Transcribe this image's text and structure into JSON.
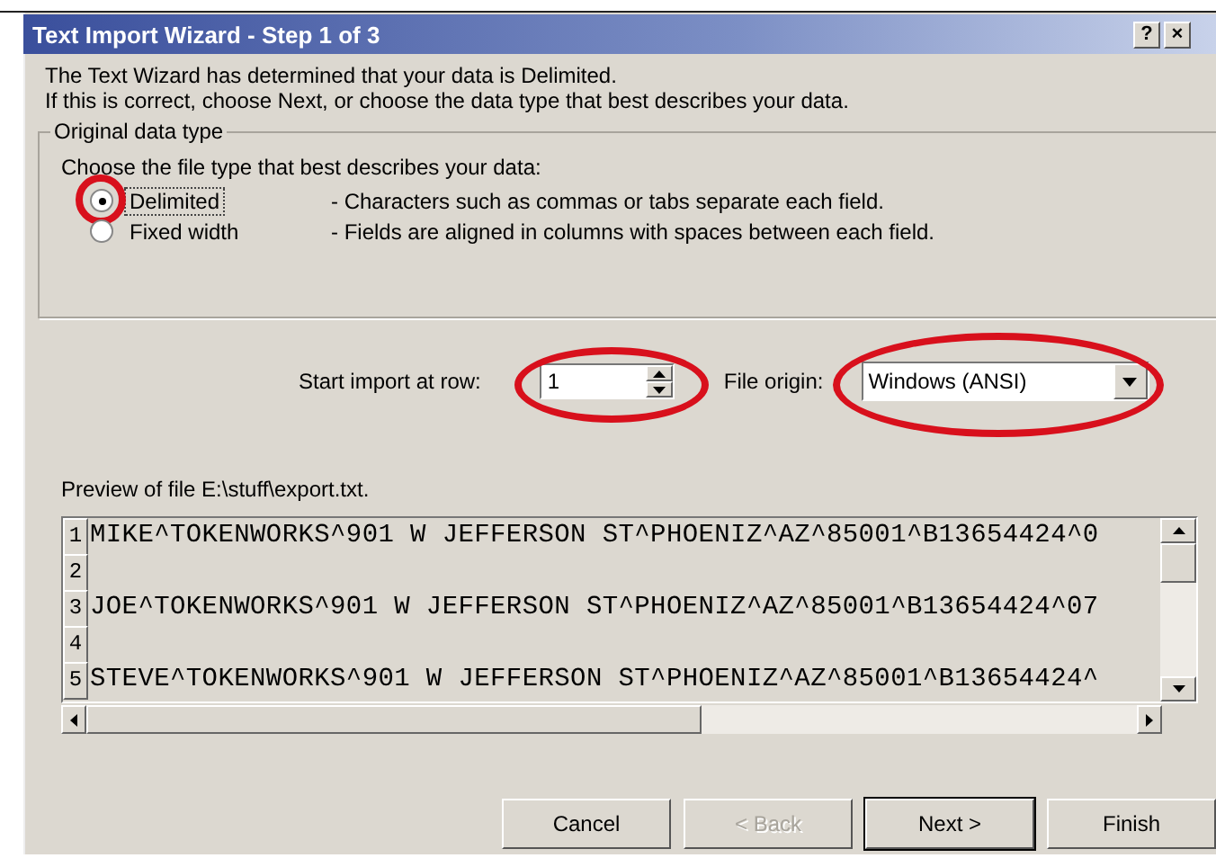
{
  "window": {
    "title": "Text Import Wizard - Step 1 of 3",
    "buttons": [
      "?",
      "×"
    ]
  },
  "intro": [
    "The Text Wizard has determined that your data is Delimited.",
    "If this is correct, choose Next, or choose the data type that best describes your data."
  ],
  "group": {
    "label": "Original data type",
    "prompt": "Choose the file type that best describes your data:",
    "options": [
      {
        "label": "Delimited",
        "description": "- Characters such as commas or tabs separate each field.",
        "selected": true,
        "focused": true,
        "circled": true
      },
      {
        "label": "Fixed width",
        "description": "- Fields are aligned in columns with spaces between each field.",
        "selected": false,
        "focused": false,
        "circled": false
      }
    ]
  },
  "start_row": {
    "label": "Start import at row:",
    "value": "1",
    "circled": true
  },
  "file_origin": {
    "label": "File origin:",
    "value": "Windows (ANSI)",
    "circled": true
  },
  "preview": {
    "label": "Preview of file E:\\stuff\\export.txt.",
    "rows": [
      {
        "number": "1",
        "text": "MIKE^TOKENWORKS^901 W JEFFERSON ST^PHOENIZ^AZ^85001^B13654424^0"
      },
      {
        "number": "2",
        "text": ""
      },
      {
        "number": "3",
        "text": "JOE^TOKENWORKS^901 W JEFFERSON ST^PHOENIZ^AZ^85001^B13654424^07"
      },
      {
        "number": "4",
        "text": ""
      },
      {
        "number": "5",
        "text": "STEVE^TOKENWORKS^901 W JEFFERSON ST^PHOENIZ^AZ^85001^B13654424^"
      }
    ]
  },
  "buttons": [
    {
      "label": "Cancel",
      "disabled": false,
      "default": false
    },
    {
      "label": "< Back",
      "disabled": true,
      "default": false
    },
    {
      "label": "Next >",
      "disabled": false,
      "default": true
    },
    {
      "label": "Finish",
      "disabled": false,
      "default": false
    }
  ]
}
